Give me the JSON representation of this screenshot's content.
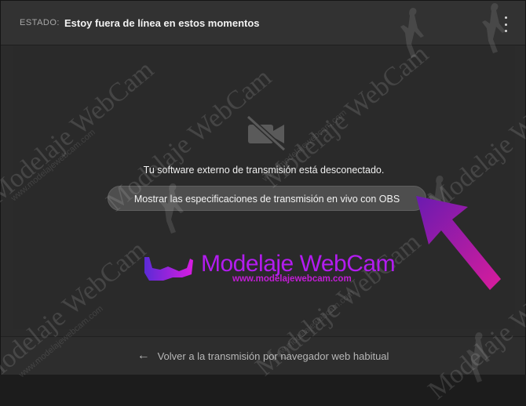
{
  "header": {
    "status_label": "ESTADO:",
    "status_value": "Estoy fuera de línea en estos momentos",
    "menu_icon": "kebab-menu-icon"
  },
  "main": {
    "camera_icon": "video-camera-off-icon",
    "disconnected_message": "Tu software externo de transmisión está desconectado.",
    "obs_button_label": "Mostrar las especificaciones de transmisión en vivo con OBS"
  },
  "footer": {
    "back_icon": "arrow-left-icon",
    "back_label": "Volver a la transmisión por navegador web habitual"
  },
  "watermark": {
    "brand_name": "Modelaje WebCam",
    "brand_url": "www.modelajewebcam.com",
    "repeated_text": "Modelaje WebCam",
    "repeated_url": "www.modelajewebcam.com"
  },
  "colors": {
    "brand_purple": "#b31cf0",
    "arrow_gradient_start": "#6a1bb0",
    "arrow_gradient_end": "#d81c9c"
  }
}
